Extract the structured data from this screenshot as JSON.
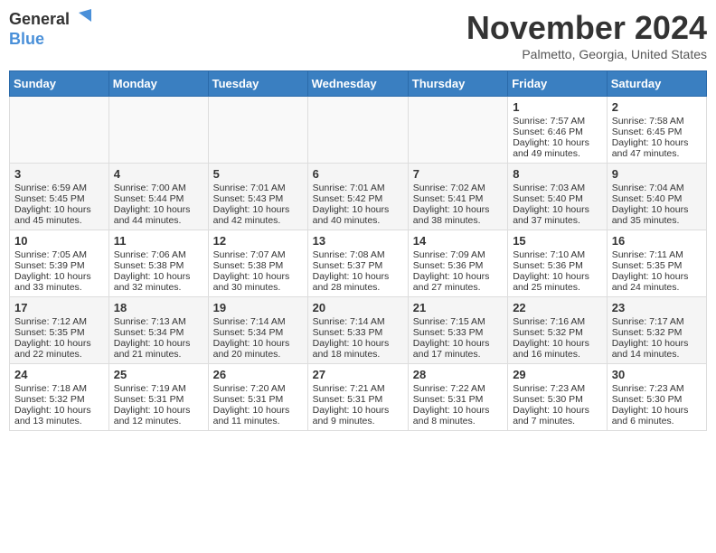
{
  "header": {
    "logo_general": "General",
    "logo_blue": "Blue",
    "month": "November 2024",
    "location": "Palmetto, Georgia, United States"
  },
  "days_of_week": [
    "Sunday",
    "Monday",
    "Tuesday",
    "Wednesday",
    "Thursday",
    "Friday",
    "Saturday"
  ],
  "weeks": [
    [
      {
        "day": "",
        "info": ""
      },
      {
        "day": "",
        "info": ""
      },
      {
        "day": "",
        "info": ""
      },
      {
        "day": "",
        "info": ""
      },
      {
        "day": "",
        "info": ""
      },
      {
        "day": "1",
        "info": "Sunrise: 7:57 AM\nSunset: 6:46 PM\nDaylight: 10 hours\nand 49 minutes."
      },
      {
        "day": "2",
        "info": "Sunrise: 7:58 AM\nSunset: 6:45 PM\nDaylight: 10 hours\nand 47 minutes."
      }
    ],
    [
      {
        "day": "3",
        "info": "Sunrise: 6:59 AM\nSunset: 5:45 PM\nDaylight: 10 hours\nand 45 minutes."
      },
      {
        "day": "4",
        "info": "Sunrise: 7:00 AM\nSunset: 5:44 PM\nDaylight: 10 hours\nand 44 minutes."
      },
      {
        "day": "5",
        "info": "Sunrise: 7:01 AM\nSunset: 5:43 PM\nDaylight: 10 hours\nand 42 minutes."
      },
      {
        "day": "6",
        "info": "Sunrise: 7:01 AM\nSunset: 5:42 PM\nDaylight: 10 hours\nand 40 minutes."
      },
      {
        "day": "7",
        "info": "Sunrise: 7:02 AM\nSunset: 5:41 PM\nDaylight: 10 hours\nand 38 minutes."
      },
      {
        "day": "8",
        "info": "Sunrise: 7:03 AM\nSunset: 5:40 PM\nDaylight: 10 hours\nand 37 minutes."
      },
      {
        "day": "9",
        "info": "Sunrise: 7:04 AM\nSunset: 5:40 PM\nDaylight: 10 hours\nand 35 minutes."
      }
    ],
    [
      {
        "day": "10",
        "info": "Sunrise: 7:05 AM\nSunset: 5:39 PM\nDaylight: 10 hours\nand 33 minutes."
      },
      {
        "day": "11",
        "info": "Sunrise: 7:06 AM\nSunset: 5:38 PM\nDaylight: 10 hours\nand 32 minutes."
      },
      {
        "day": "12",
        "info": "Sunrise: 7:07 AM\nSunset: 5:38 PM\nDaylight: 10 hours\nand 30 minutes."
      },
      {
        "day": "13",
        "info": "Sunrise: 7:08 AM\nSunset: 5:37 PM\nDaylight: 10 hours\nand 28 minutes."
      },
      {
        "day": "14",
        "info": "Sunrise: 7:09 AM\nSunset: 5:36 PM\nDaylight: 10 hours\nand 27 minutes."
      },
      {
        "day": "15",
        "info": "Sunrise: 7:10 AM\nSunset: 5:36 PM\nDaylight: 10 hours\nand 25 minutes."
      },
      {
        "day": "16",
        "info": "Sunrise: 7:11 AM\nSunset: 5:35 PM\nDaylight: 10 hours\nand 24 minutes."
      }
    ],
    [
      {
        "day": "17",
        "info": "Sunrise: 7:12 AM\nSunset: 5:35 PM\nDaylight: 10 hours\nand 22 minutes."
      },
      {
        "day": "18",
        "info": "Sunrise: 7:13 AM\nSunset: 5:34 PM\nDaylight: 10 hours\nand 21 minutes."
      },
      {
        "day": "19",
        "info": "Sunrise: 7:14 AM\nSunset: 5:34 PM\nDaylight: 10 hours\nand 20 minutes."
      },
      {
        "day": "20",
        "info": "Sunrise: 7:14 AM\nSunset: 5:33 PM\nDaylight: 10 hours\nand 18 minutes."
      },
      {
        "day": "21",
        "info": "Sunrise: 7:15 AM\nSunset: 5:33 PM\nDaylight: 10 hours\nand 17 minutes."
      },
      {
        "day": "22",
        "info": "Sunrise: 7:16 AM\nSunset: 5:32 PM\nDaylight: 10 hours\nand 16 minutes."
      },
      {
        "day": "23",
        "info": "Sunrise: 7:17 AM\nSunset: 5:32 PM\nDaylight: 10 hours\nand 14 minutes."
      }
    ],
    [
      {
        "day": "24",
        "info": "Sunrise: 7:18 AM\nSunset: 5:32 PM\nDaylight: 10 hours\nand 13 minutes."
      },
      {
        "day": "25",
        "info": "Sunrise: 7:19 AM\nSunset: 5:31 PM\nDaylight: 10 hours\nand 12 minutes."
      },
      {
        "day": "26",
        "info": "Sunrise: 7:20 AM\nSunset: 5:31 PM\nDaylight: 10 hours\nand 11 minutes."
      },
      {
        "day": "27",
        "info": "Sunrise: 7:21 AM\nSunset: 5:31 PM\nDaylight: 10 hours\nand 9 minutes."
      },
      {
        "day": "28",
        "info": "Sunrise: 7:22 AM\nSunset: 5:31 PM\nDaylight: 10 hours\nand 8 minutes."
      },
      {
        "day": "29",
        "info": "Sunrise: 7:23 AM\nSunset: 5:30 PM\nDaylight: 10 hours\nand 7 minutes."
      },
      {
        "day": "30",
        "info": "Sunrise: 7:23 AM\nSunset: 5:30 PM\nDaylight: 10 hours\nand 6 minutes."
      }
    ]
  ]
}
